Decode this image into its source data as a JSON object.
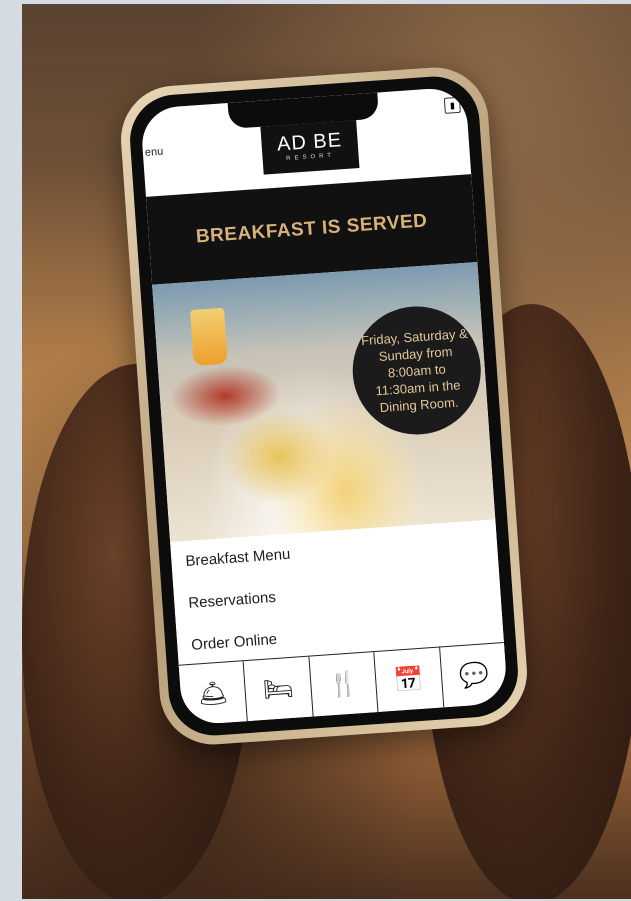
{
  "screen": {
    "menu_label": "enu",
    "logo": {
      "word": "AD BE",
      "sub": "RESORT"
    },
    "banner_title": "BREAKFAST IS SERVED",
    "hours": "Friday, Saturday & Sunday from 8:00am to 11:30am in the Dining Room.",
    "links": [
      "Breakfast Menu",
      "Reservations",
      "Order Online"
    ],
    "tabs": [
      {
        "name": "room-service-icon",
        "glyph": "🛎"
      },
      {
        "name": "bed-icon",
        "glyph": "🛏"
      },
      {
        "name": "dining-icon",
        "glyph": "🍴"
      },
      {
        "name": "calendar-icon",
        "glyph": "📅"
      },
      {
        "name": "chat-icon",
        "glyph": "💬"
      }
    ]
  },
  "colors": {
    "banner": "#111111",
    "accent": "#d8b07a",
    "badge": "#1b1b1b"
  }
}
